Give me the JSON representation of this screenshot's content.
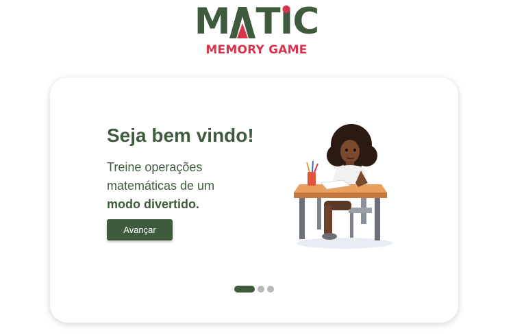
{
  "logo": {
    "word_prefix": "M",
    "word_t": "T",
    "word_i": "I",
    "word_c": "C",
    "subtitle": "MEMORY GAME",
    "primary_color": "#3f5b3d",
    "accent_color": "#d9334b"
  },
  "welcome": {
    "title": "Seja bem vindo!",
    "desc_line1": "Treine operações",
    "desc_line2": "matemáticas de um",
    "desc_bold": "modo divertido.",
    "button_label": "Avançar"
  },
  "illustration": {
    "icon": "girl-studying-at-desk-illustration"
  },
  "carousel": {
    "slides_total": 3,
    "active_index": 0
  }
}
